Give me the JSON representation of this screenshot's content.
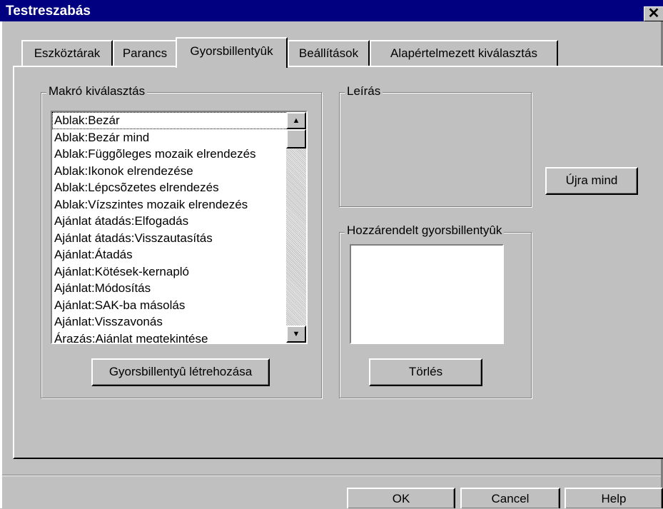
{
  "window": {
    "title": "Testreszabás",
    "close_glyph": "✕"
  },
  "tabs": [
    {
      "label": "Eszköztárak",
      "active": false
    },
    {
      "label": "Parancs",
      "active": false
    },
    {
      "label": "Gyorsbillentyûk",
      "active": true
    },
    {
      "label": "Beállítások",
      "active": false
    },
    {
      "label": "Alapértelmezett kiválasztás",
      "active": false
    }
  ],
  "macro_group": {
    "legend": "Makró kiválasztás",
    "items": [
      "Ablak:Bezár",
      "Ablak:Bezár mind",
      "Ablak:Függõleges mozaik elrendezés",
      "Ablak:Ikonok elrendezése",
      "Ablak:Lépcsõzetes elrendezés",
      "Ablak:Vízszintes mozaik elrendezés",
      "Ajánlat átadás:Elfogadás",
      "Ajánlat átadás:Visszautasítás",
      "Ajánlat:Átadás",
      "Ajánlat:Kötések-kernapló",
      "Ajánlat:Módosítás",
      "Ajánlat:SAK-ba másolás",
      "Ajánlat:Visszavonás",
      "Árazás:Ajánlat megtekintése"
    ],
    "selected_index": 0,
    "create_button": "Gyorsbillentyû létrehozása"
  },
  "description_group": {
    "legend": "Leírás"
  },
  "assigned_group": {
    "legend": "Hozzárendelt gyorsbillentyûk",
    "delete_button": "Törlés"
  },
  "reset_all_button": "Újra mind",
  "footer": {
    "ok": "OK",
    "cancel": "Cancel",
    "help": "Help"
  },
  "icons": {
    "scroll_up": "▲",
    "scroll_down": "▼"
  }
}
